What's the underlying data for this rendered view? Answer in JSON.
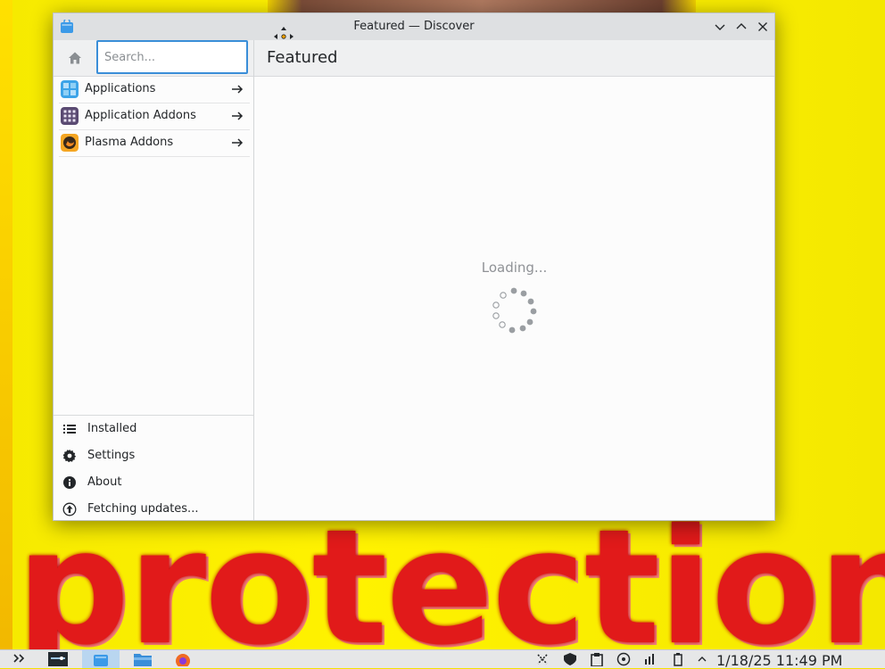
{
  "window": {
    "title": "Featured — Discover"
  },
  "sidebar": {
    "search_placeholder": "Search...",
    "categories": [
      {
        "label": "Applications",
        "icon": "applications-icon"
      },
      {
        "label": "Application Addons",
        "icon": "app-addons-icon"
      },
      {
        "label": "Plasma Addons",
        "icon": "plasma-addons-icon"
      }
    ],
    "actions": [
      {
        "label": "Installed",
        "icon": "list-icon"
      },
      {
        "label": "Settings",
        "icon": "gear-icon"
      },
      {
        "label": "About",
        "icon": "info-icon"
      },
      {
        "label": "Fetching updates...",
        "icon": "update-icon"
      }
    ]
  },
  "main": {
    "page_title": "Featured",
    "loading_text": "Loading..."
  },
  "taskbar": {
    "clock": "1/18/25 11:49 PM"
  },
  "wallpaper": {
    "word": "protection"
  },
  "colors": {
    "accent": "#3a8ed8",
    "wallpaper_yellow": "#f3e400",
    "wallpaper_red": "#e11a1a"
  }
}
